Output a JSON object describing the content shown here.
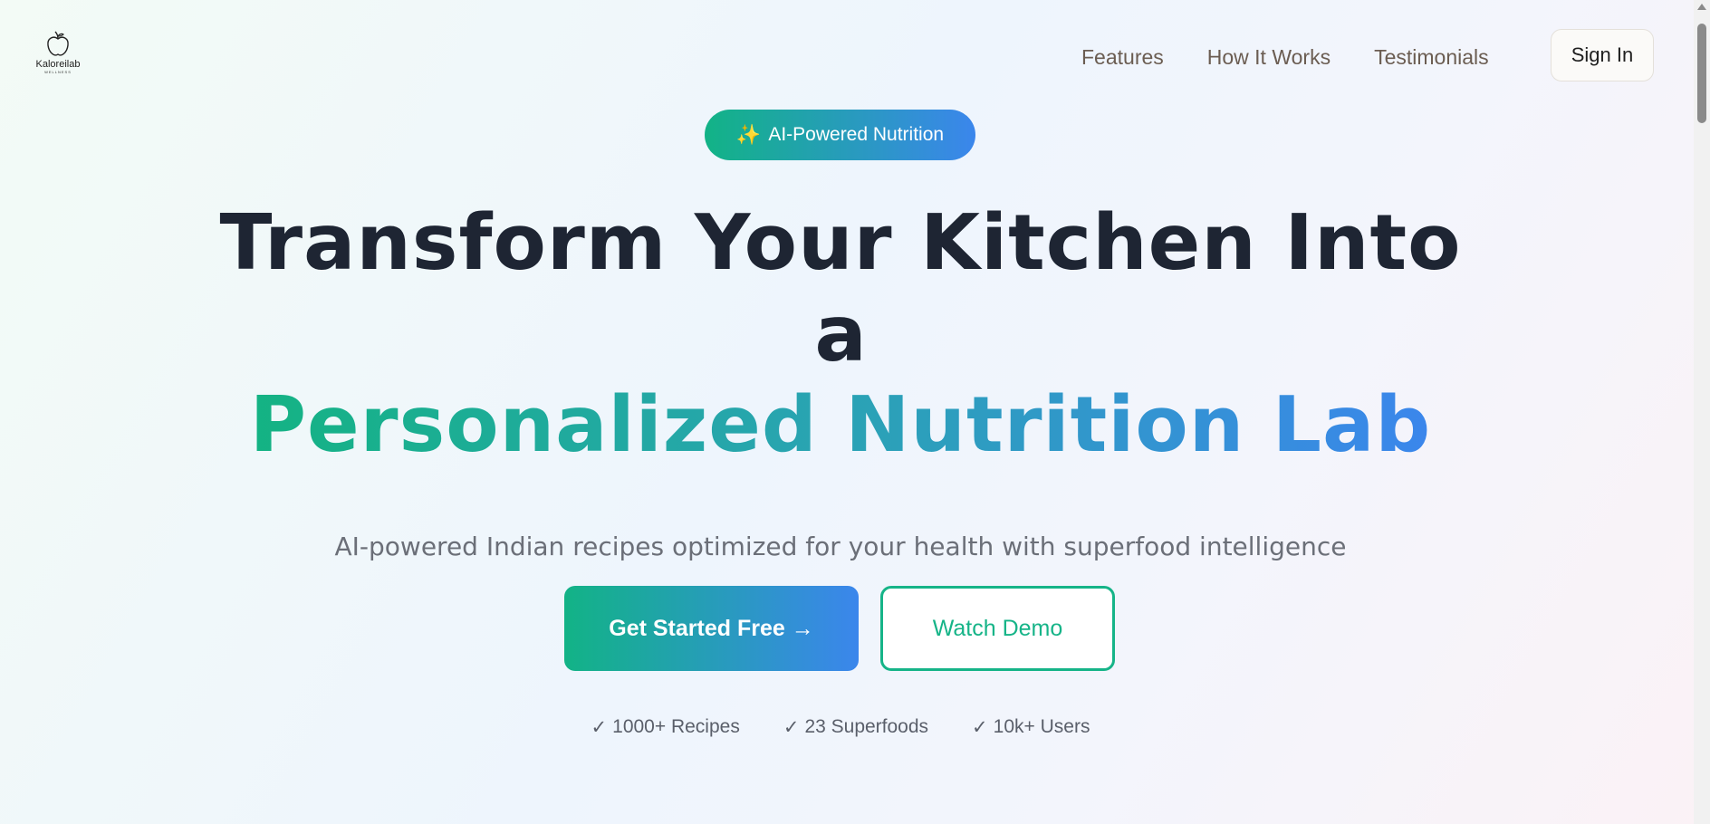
{
  "header": {
    "logo": {
      "brand": "Kaloreilab",
      "sub": "WELLNESS"
    },
    "nav": [
      {
        "label": "Features"
      },
      {
        "label": "How It Works"
      },
      {
        "label": "Testimonials"
      }
    ],
    "signin_label": "Sign In"
  },
  "hero": {
    "badge": {
      "icon": "✨",
      "label": "AI-Powered Nutrition"
    },
    "headline_line1": "Transform Your Kitchen Into",
    "headline_line2": "a",
    "headline_line3": "Personalized Nutrition Lab",
    "subtitle": "AI-powered Indian recipes optimized for your health with superfood intelligence",
    "cta_primary": "Get Started Free →",
    "cta_secondary": "Watch Demo",
    "stats": [
      {
        "check": "✓",
        "label": "1000+ Recipes"
      },
      {
        "check": "✓",
        "label": "23 Superfoods"
      },
      {
        "check": "✓",
        "label": "10k+ Users"
      }
    ]
  },
  "colors": {
    "accent_green": "#12b386",
    "accent_blue": "#3b86ec",
    "headline": "#1e2533"
  }
}
